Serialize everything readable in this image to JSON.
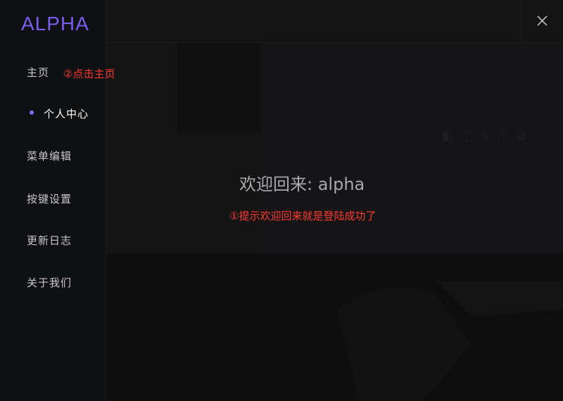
{
  "app": {
    "logo": "ALPHA"
  },
  "sidebar": {
    "items": [
      {
        "label": "主页"
      },
      {
        "label": "个人中心"
      },
      {
        "label": "菜单编辑"
      },
      {
        "label": "按键设置"
      },
      {
        "label": "更新日志"
      },
      {
        "label": "关于我们"
      }
    ],
    "active_index": 1
  },
  "annotations": {
    "click_home": "②点击主页",
    "login_success": "①提示欢迎回来就是登陆成功了"
  },
  "main": {
    "welcome_text": "欢迎回来: alpha"
  },
  "colors": {
    "accent": "#7b5cf0",
    "annotation": "#ff3b30",
    "background": "#141415",
    "sidebar": "#0f1012"
  },
  "icons": {
    "close": "close-icon",
    "active_indicator": "dot-icon"
  }
}
